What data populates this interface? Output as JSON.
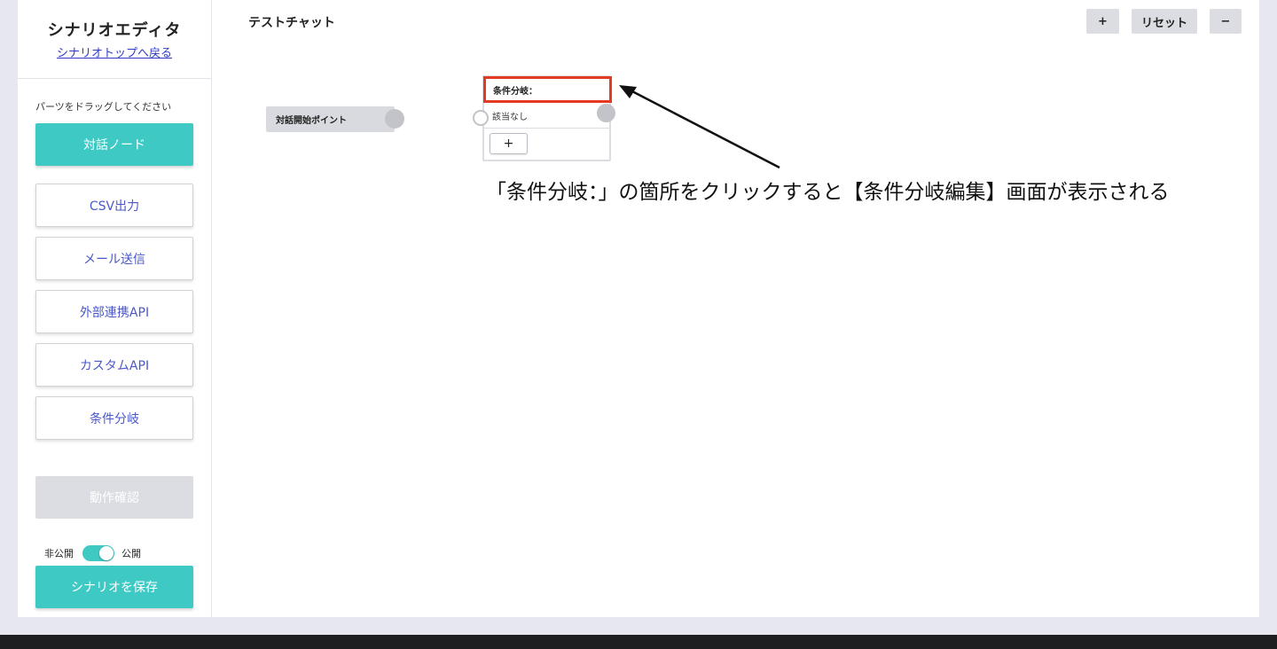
{
  "sidebar": {
    "title": "シナリオエディタ",
    "back_link": "シナリオトップへ戻る",
    "drag_hint": "パーツをドラッグしてください",
    "dialog_node_label": "対話ノード",
    "parts": [
      {
        "label": "CSV出力"
      },
      {
        "label": "メール送信"
      },
      {
        "label": "外部連携API"
      },
      {
        "label": "カスタムAPI"
      },
      {
        "label": "条件分岐"
      }
    ],
    "test_run_label": "動作確認",
    "private_label": "非公開",
    "public_label": "公開",
    "publish_toggle_on": true,
    "save_label": "シナリオを保存"
  },
  "canvas": {
    "title": "テストチャット",
    "toolbar": {
      "zoom_in_label": "+",
      "reset_label": "リセット",
      "zoom_out_label": "−"
    },
    "start_node_label": "対話開始ポイント",
    "condition_node": {
      "header_label": "条件分岐：",
      "row_label": "該当なし",
      "add_label": "+"
    },
    "annotation_text": "「条件分岐：」の箇所をクリックすると【条件分岐編集】画面が表示される"
  },
  "colors": {
    "accent": "#3ec9c4",
    "link": "#2e3cc4",
    "part_text": "#4a58c8",
    "highlight": "#e53a22"
  }
}
